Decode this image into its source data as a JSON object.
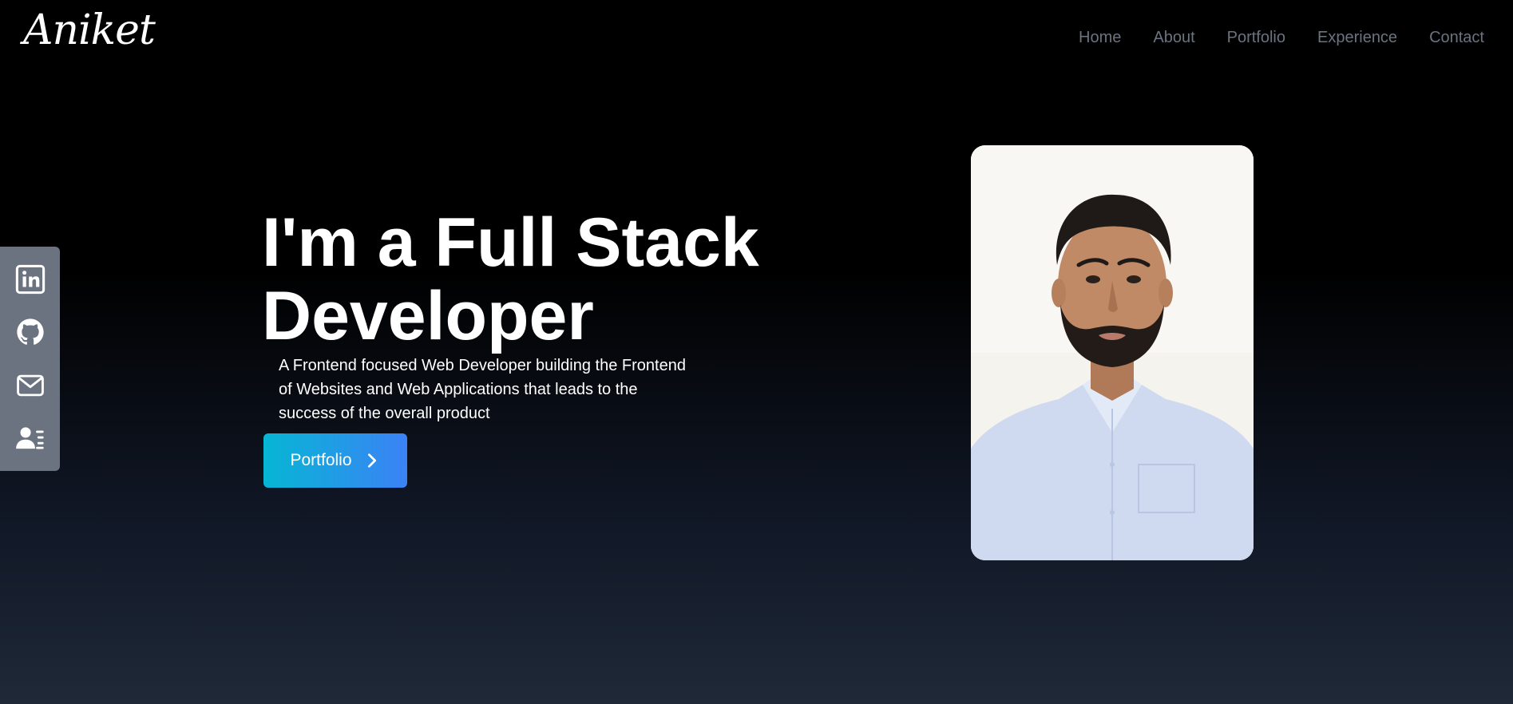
{
  "navbar": {
    "logo": "Aniket",
    "links": [
      "Home",
      "About",
      "Portfolio",
      "Experience",
      "Contact"
    ]
  },
  "social": {
    "icons": [
      "linkedin-icon",
      "github-icon",
      "mail-icon",
      "resume-icon"
    ]
  },
  "hero": {
    "title_line1": "I'm a Full Stack",
    "title_line2": "Developer",
    "description": "A Frontend focused Web Developer building the Frontend of Websites and Web Applications that leads to the success of the overall product",
    "cta_label": "Portfolio"
  },
  "colors": {
    "accent_start": "#06b6d4",
    "accent_end": "#3b82f6",
    "nav_text": "#6b7280",
    "social_bar": "#6b7280"
  }
}
